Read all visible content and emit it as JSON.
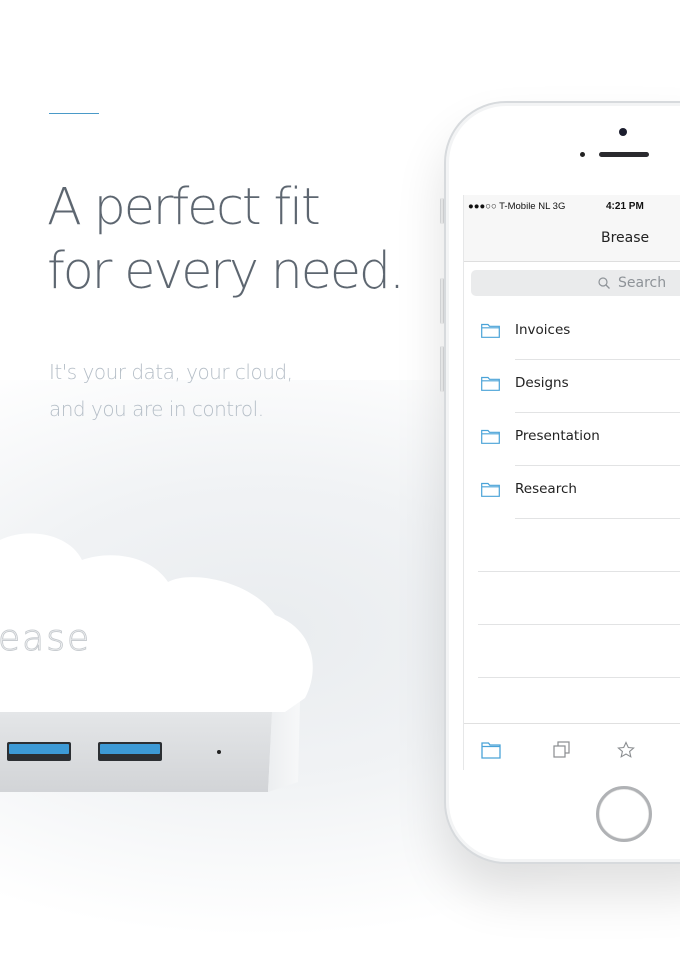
{
  "hero": {
    "headline_line1": "A perfect fit",
    "headline_line2": "for every need.",
    "subtext_line1": "It's your data, your cloud,",
    "subtext_line2": "and you are in control.",
    "accent_color": "#4a9ac8"
  },
  "device": {
    "logo_text": "ease",
    "usb_port_color": "#3d9ad6"
  },
  "phone": {
    "status_bar": {
      "carrier": "●●●○○ T-Mobile NL  3G",
      "time": "4:21 PM"
    },
    "nav_title": "Brease",
    "search": {
      "placeholder": "Search",
      "icon": "search-icon"
    },
    "folders": [
      {
        "label": "Invoices",
        "icon": "folder-icon"
      },
      {
        "label": "Designs",
        "icon": "folder-icon"
      },
      {
        "label": "Presentation",
        "icon": "folder-icon"
      },
      {
        "label": "Research",
        "icon": "folder-icon"
      }
    ],
    "tabbar": [
      {
        "name": "files",
        "icon": "folder-icon",
        "active": true
      },
      {
        "name": "copies",
        "icon": "copy-icon",
        "active": false
      },
      {
        "name": "favorites",
        "icon": "star-icon",
        "active": false
      }
    ],
    "accent_color": "#4aa3d8"
  }
}
